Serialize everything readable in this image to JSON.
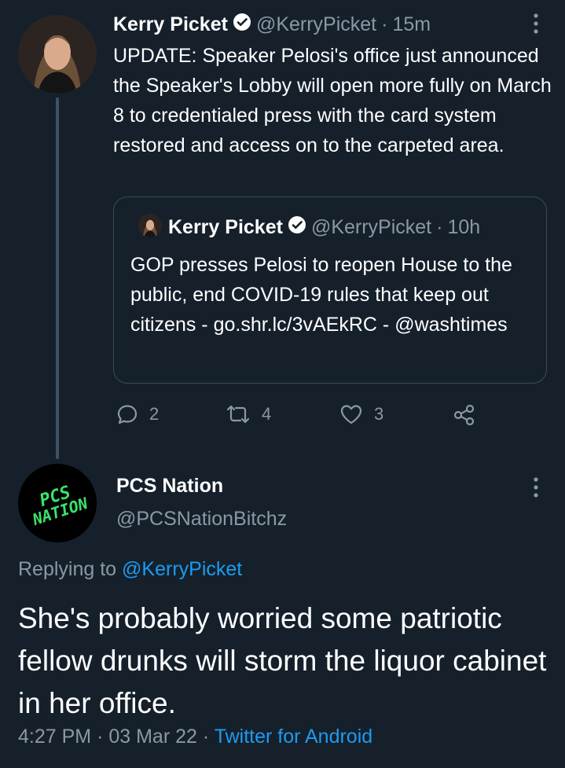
{
  "tweet1": {
    "name": "Kerry Picket",
    "handle": "@KerryPicket",
    "sep": "·",
    "time": "15m",
    "text": "UPDATE: Speaker Pelosi's office just announced the Speaker's Lobby will open more fully on March 8 to credentialed press with the card system restored and access on to the carpeted area.",
    "quote": {
      "name": "Kerry Picket",
      "handle": "@KerryPicket",
      "sep": "·",
      "time": "10h",
      "text": "GOP presses Pelosi to reopen House to the public, end COVID-19 rules that keep out citizens - go.shr.lc/3vAEkRC - @washtimes"
    },
    "actions": {
      "replies": "2",
      "retweets": "4",
      "likes": "3"
    }
  },
  "tweet2": {
    "name": "PCS Nation",
    "handle": "@PCSNationBitchz",
    "avatar_text_line1": "PCS",
    "avatar_text_line2": "NATION",
    "replying_prefix": "Replying to",
    "replying_handle": "@KerryPicket",
    "text": "She's probably worried some patriotic fellow drunks will storm the liquor cabinet in her office.",
    "time": "4:27 PM",
    "sep1": "·",
    "date": "03 Mar 22",
    "sep2": "·",
    "source": "Twitter for Android"
  },
  "colors": {
    "background": "#15202b",
    "muted": "#8b98a5",
    "link": "#1d9bf0",
    "thread_line": "#3d5466",
    "avatar_logo_green": "#39e36b"
  }
}
